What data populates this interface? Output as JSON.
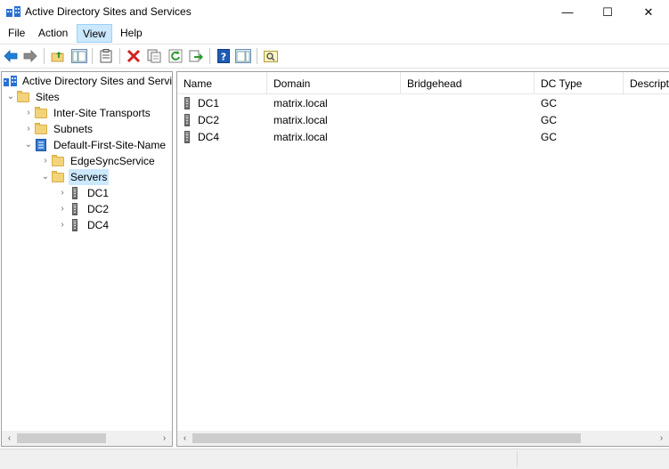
{
  "window": {
    "title": "Active Directory Sites and Services",
    "minimize": "—",
    "maximize": "☐",
    "close": "✕"
  },
  "menu": {
    "file": "File",
    "action": "Action",
    "view": "View",
    "help": "Help"
  },
  "toolbar": {
    "icons": [
      "back-arrow-icon",
      "forward-arrow-icon",
      "up-folder-icon",
      "show-hide-console-tree-icon",
      "properties-icon",
      "delete-icon",
      "copy-icon",
      "refresh-icon",
      "export-list-icon",
      "help-icon",
      "show-hide-action-pane-icon",
      "find-icon"
    ]
  },
  "tree": {
    "root": "Active Directory Sites and Services",
    "sites": "Sites",
    "inter_site_transports": "Inter-Site Transports",
    "subnets": "Subnets",
    "default_site": "Default-First-Site-Name",
    "edgesync": "EdgeSyncService",
    "servers": "Servers",
    "dc1": "DC1",
    "dc2": "DC2",
    "dc4": "DC4"
  },
  "list": {
    "columns": {
      "name": "Name",
      "domain": "Domain",
      "bridgehead": "Bridgehead",
      "dc_type": "DC Type",
      "description": "Descript"
    },
    "rows": [
      {
        "name": "DC1",
        "domain": "matrix.local",
        "bridgehead": "",
        "dc_type": "GC"
      },
      {
        "name": "DC2",
        "domain": "matrix.local",
        "bridgehead": "",
        "dc_type": "GC"
      },
      {
        "name": "DC4",
        "domain": "matrix.local",
        "bridgehead": "",
        "dc_type": "GC"
      }
    ]
  },
  "colors": {
    "selection": "#cce8ff",
    "accent_blue": "#1f6fd6"
  }
}
